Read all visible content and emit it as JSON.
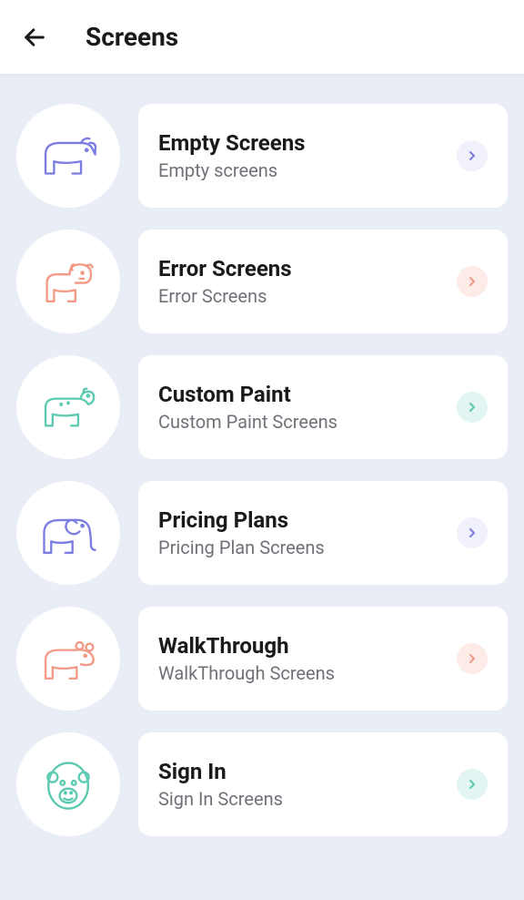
{
  "header": {
    "title": "Screens"
  },
  "items": [
    {
      "title": "Empty Screens",
      "subtitle": "Empty screens",
      "icon": "rhino-icon",
      "color": "purple"
    },
    {
      "title": "Error Screens",
      "subtitle": "Error Screens",
      "icon": "lion-icon",
      "color": "coral"
    },
    {
      "title": "Custom Paint",
      "subtitle": "Custom Paint Screens",
      "icon": "cheetah-icon",
      "color": "teal"
    },
    {
      "title": "Pricing Plans",
      "subtitle": "Pricing Plan Screens",
      "icon": "elephant-icon",
      "color": "purple"
    },
    {
      "title": "WalkThrough",
      "subtitle": "WalkThrough Screens",
      "icon": "hippo-icon",
      "color": "coral"
    },
    {
      "title": "Sign In",
      "subtitle": "Sign In Screens",
      "icon": "gorilla-icon",
      "color": "teal"
    }
  ],
  "colors": {
    "purple": "#7c7de0",
    "coral": "#f29a85",
    "teal": "#5cc9b1"
  }
}
